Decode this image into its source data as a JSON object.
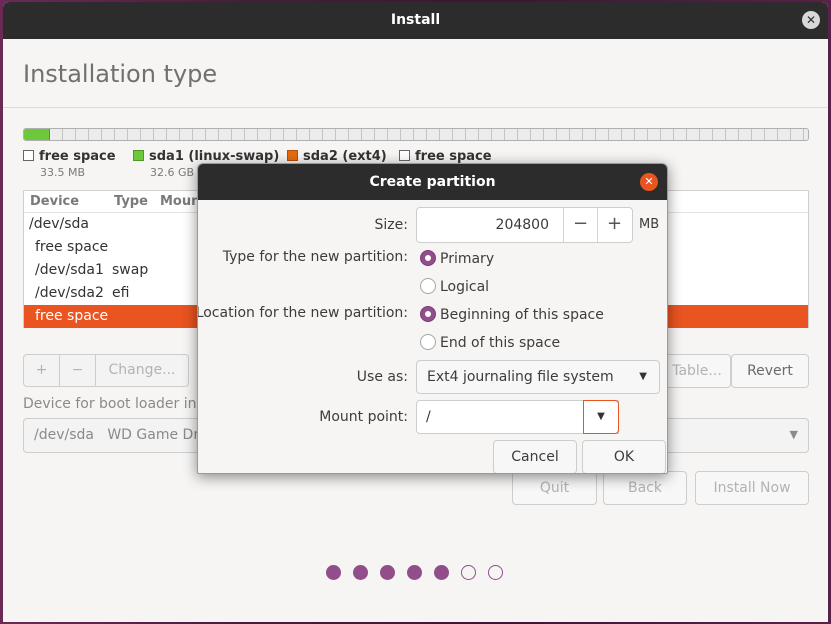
{
  "window": {
    "title": "Install"
  },
  "page": {
    "heading": "Installation type"
  },
  "legend": [
    {
      "name": "free space",
      "size": "33.5 MB",
      "color": "#ffffff"
    },
    {
      "name": "sda1 (linux-swap)",
      "size": "32.6 GB",
      "color": "#6cc93b"
    },
    {
      "name": "sda2 (ext4)",
      "size": "",
      "color": "#e66a0d"
    },
    {
      "name": "free space",
      "size": "",
      "color": "#ffffff"
    }
  ],
  "table": {
    "headers": {
      "device": "Device",
      "type": "Type",
      "mount": "Moun"
    },
    "rows": [
      {
        "device": "/dev/sda",
        "type": ""
      },
      {
        "device": "free space",
        "type": ""
      },
      {
        "device": "/dev/sda1",
        "type": "swap"
      },
      {
        "device": "/dev/sda2",
        "type": "efi"
      },
      {
        "device": "free space",
        "type": "",
        "selected": true
      }
    ]
  },
  "table_buttons": {
    "add": "+",
    "remove": "−",
    "change": "Change...",
    "new_table": "Table...",
    "revert": "Revert"
  },
  "boot_loader": {
    "label": "Device for boot loader inst",
    "device": "/dev/sda",
    "description": "WD Game Driv"
  },
  "nav": {
    "quit": "Quit",
    "back": "Back",
    "install_now": "Install Now"
  },
  "progress_dots": {
    "total": 7,
    "filled": 5,
    "color": "#924d8b"
  },
  "dialog": {
    "title": "Create partition",
    "size_label": "Size:",
    "size_value": "204800",
    "size_unit": "MB",
    "minus": "−",
    "plus": "+",
    "type_label": "Type for the new partition:",
    "type_options": {
      "primary": "Primary",
      "logical": "Logical"
    },
    "type_selected": "Primary",
    "location_label": "Location for the new partition:",
    "location_options": {
      "beginning": "Beginning of this space",
      "end": "End of this space"
    },
    "location_selected": "Beginning of this space",
    "use_as_label": "Use as:",
    "use_as_value": "Ext4 journaling file system",
    "mount_label": "Mount point:",
    "mount_value": "/",
    "cancel": "Cancel",
    "ok": "OK"
  },
  "colors": {
    "accent": "#e95420",
    "aubergine": "#924d8b",
    "titlebar": "#2c2c2c"
  }
}
